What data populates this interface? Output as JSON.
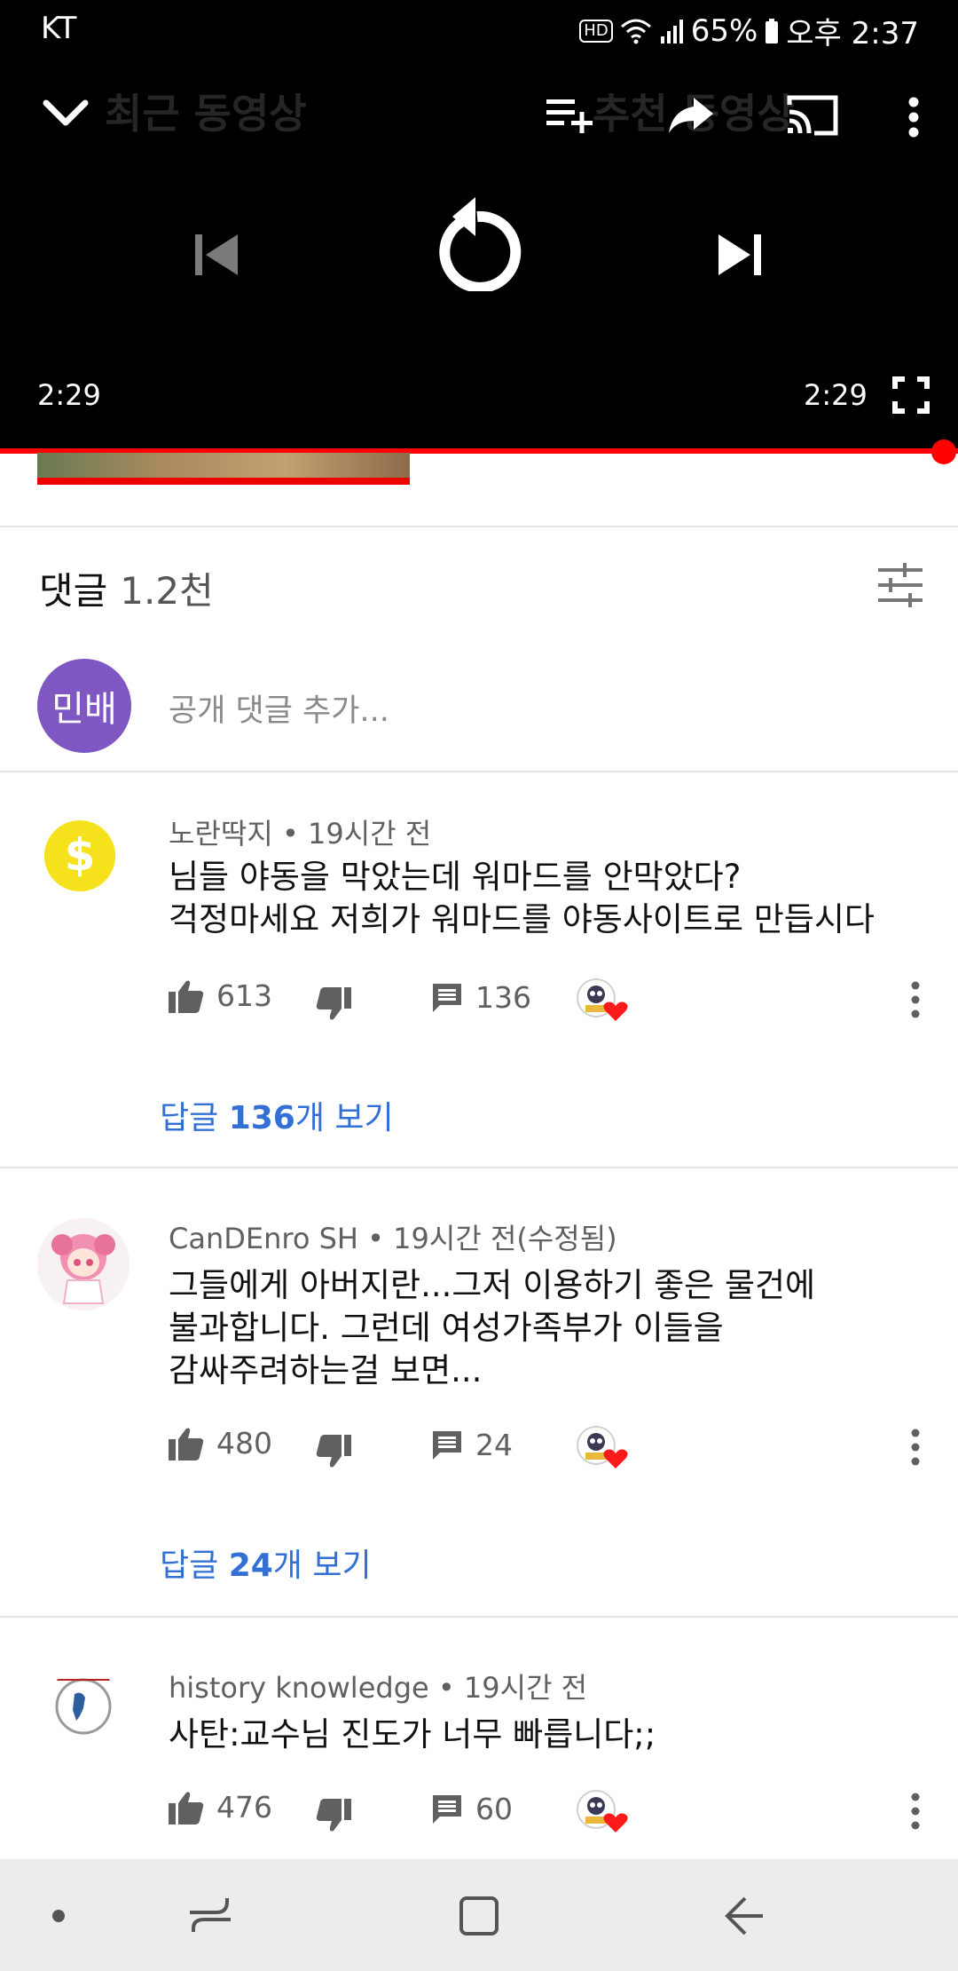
{
  "status_bar": {
    "carrier": "KT",
    "hd": "HD",
    "battery": "65%",
    "time": "오후 2:37"
  },
  "player": {
    "ghost_title_left": "최근 동영상",
    "ghost_title_right": "추천 동영상",
    "elapsed": "2:29",
    "duration": "2:29",
    "progress": 1.0
  },
  "comments": {
    "title": "댓글",
    "count": "1.2천",
    "my_avatar_text": "민배",
    "add_placeholder": "공개 댓글 추가...",
    "items": [
      {
        "author": "노란딱지",
        "time": "19시간 전",
        "lines": [
          "님들 야동을 막았는데 워마드를 안막았다?",
          "걱정마세요 저희가 워마드를 야동사이트로 만듭시다"
        ],
        "likes": "613",
        "replies": "136",
        "replies_prefix": "답글 ",
        "replies_bold": "136",
        "replies_suffix": "개 보기"
      },
      {
        "author": "CanDEnro SH",
        "time": "19시간 전(수정됨)",
        "lines": [
          "그들에게 아버지란...그저 이용하기 좋은 물건에",
          "불과합니다. 그런데 여성가족부가 이들을",
          "감싸주려하는걸 보면..."
        ],
        "likes": "480",
        "replies": "24",
        "replies_prefix": "답글 ",
        "replies_bold": "24",
        "replies_suffix": "개 보기"
      },
      {
        "author": "history knowledge",
        "time": "19시간 전",
        "lines": [
          "사탄:교수님 진도가 너무 빠릅니다;;"
        ],
        "likes": "476",
        "replies": "60"
      }
    ]
  },
  "colors": {
    "accent": "#ff0000",
    "link": "#3370d6",
    "my_avatar": "#7e57c2"
  },
  "icons": [
    "collapse-chevron-icon",
    "add-to-queue-icon",
    "share-icon",
    "cast-icon",
    "more-vert-icon",
    "previous-icon",
    "replay-icon",
    "next-icon",
    "fullscreen-icon",
    "sort-comments-icon",
    "thumb-up-icon",
    "thumb-down-icon",
    "reply-icon",
    "creator-heart-icon"
  ]
}
